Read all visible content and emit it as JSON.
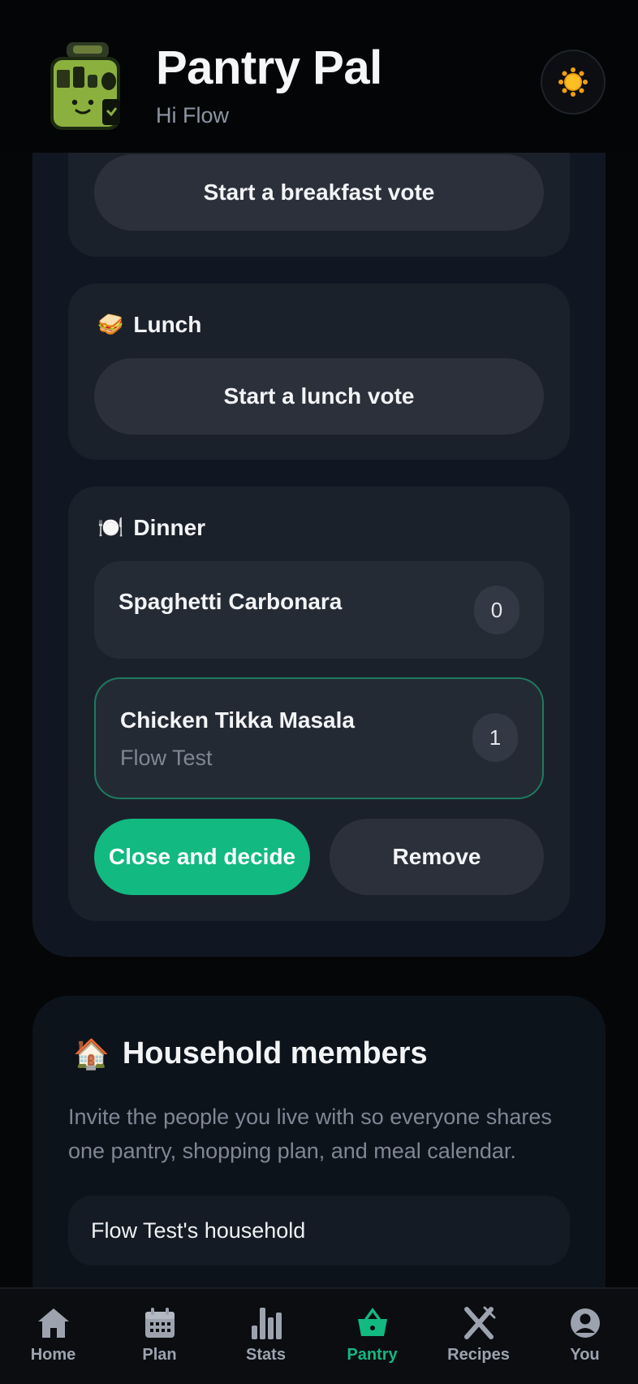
{
  "header": {
    "app_title": "Pantry Pal",
    "greeting": "Hi Flow"
  },
  "meals": {
    "breakfast": {
      "button": "Start a breakfast vote"
    },
    "lunch": {
      "emoji": "🥪",
      "title": "Lunch",
      "button": "Start a lunch vote"
    },
    "dinner": {
      "emoji": "🍽️",
      "title": "Dinner",
      "options": [
        {
          "name": "Spaghetti Carbonara",
          "votes": "0",
          "voters": ""
        },
        {
          "name": "Chicken Tikka Masala",
          "votes": "1",
          "voters": "Flow Test"
        }
      ],
      "close_button": "Close and decide",
      "remove_button": "Remove"
    }
  },
  "household": {
    "emoji": "🏠",
    "title": "Household members",
    "description": "Invite the people you live with so everyone shares one pantry, shopping plan, and meal calendar.",
    "name_value": "Flow Test's household"
  },
  "nav": {
    "items": [
      {
        "label": "Home",
        "icon": "home-icon",
        "active": false
      },
      {
        "label": "Plan",
        "icon": "calendar-icon",
        "active": false
      },
      {
        "label": "Stats",
        "icon": "bar-chart-icon",
        "active": false
      },
      {
        "label": "Pantry",
        "icon": "basket-icon",
        "active": true
      },
      {
        "label": "Recipes",
        "icon": "utensils-icon",
        "active": false
      },
      {
        "label": "You",
        "icon": "user-icon",
        "active": false
      }
    ]
  },
  "colors": {
    "accent": "#12b981",
    "background": "#050608",
    "card": "#1b212b"
  }
}
